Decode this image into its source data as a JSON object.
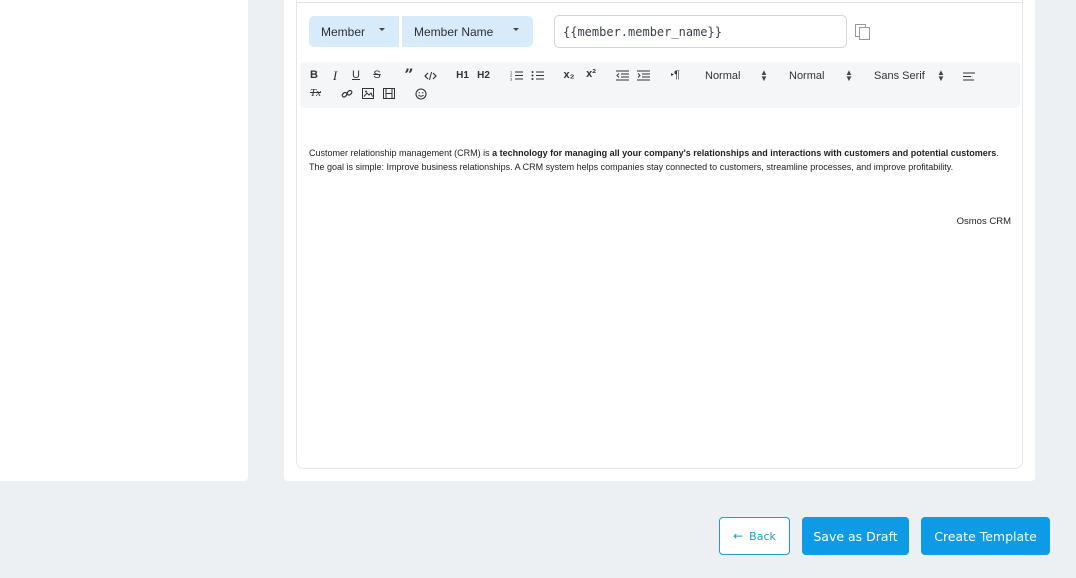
{
  "variable_picker": {
    "group_label": "Member",
    "field_label": "Member Name",
    "variable_value": "{{member.member_name}}"
  },
  "toolbar": {
    "bold": "B",
    "italic": "I",
    "underline": "U",
    "strike": "S",
    "quote": "”",
    "h1": "H1",
    "h2": "H2",
    "subscript": "x₂",
    "superscript": "x²",
    "header_select": "Normal",
    "size_select": "Normal",
    "font_select": "Sans Serif",
    "clean": "Tx",
    "icons": [
      "bold-icon",
      "italic-icon",
      "underline-icon",
      "strike-icon",
      "quote-icon",
      "code-icon",
      "h1-icon",
      "h2-icon",
      "ordered-list-icon",
      "bullet-list-icon",
      "subscript-icon",
      "superscript-icon",
      "outdent-icon",
      "indent-icon",
      "rtl-icon",
      "align-icon",
      "clean-format-icon",
      "link-icon",
      "image-icon",
      "video-icon",
      "emoji-icon"
    ]
  },
  "editor": {
    "paragraph_part1": "Customer relationship management (CRM) is ",
    "paragraph_bold": "a technology for managing all your company's relationships and interactions with customers and potential customers",
    "paragraph_part2": ". The goal is simple: Improve business relationships. A CRM system helps companies stay connected to customers, streamline processes, and improve profitability.",
    "signature": "Osmos CRM"
  },
  "actions": {
    "back": "Back",
    "save_draft": "Save as Draft",
    "create": "Create Template"
  },
  "colors": {
    "primary": "#0d9be6",
    "pill_bg": "#d8ebfb",
    "page_bg": "#edf0f3"
  }
}
